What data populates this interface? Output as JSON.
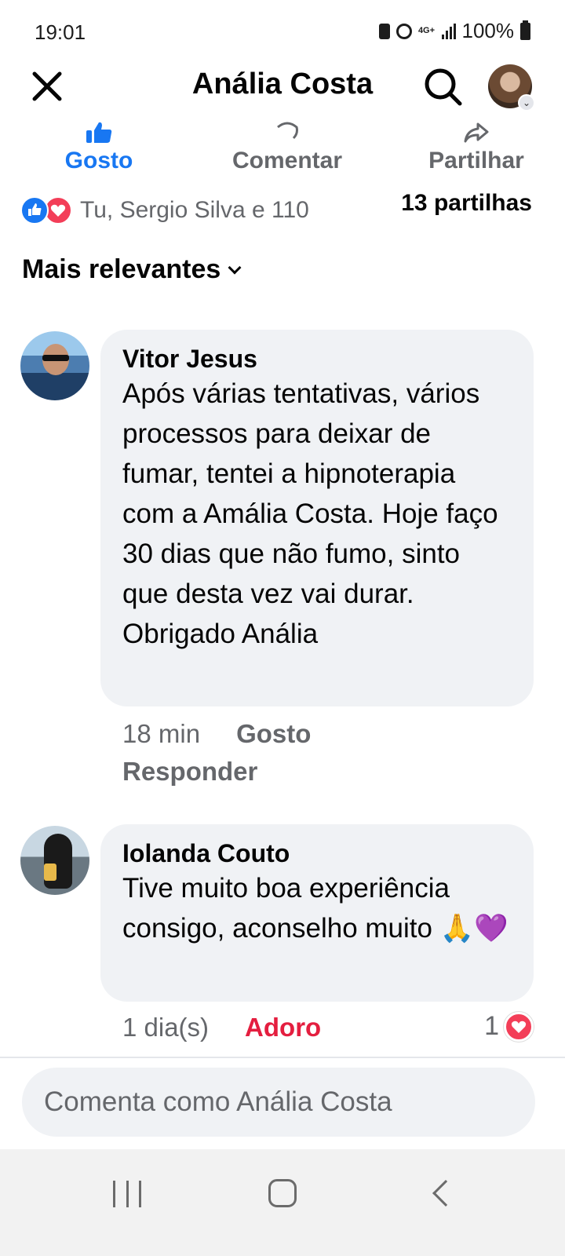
{
  "status_bar": {
    "time": "19:01",
    "network": "4G+",
    "battery": "100%"
  },
  "header": {
    "title": "Anália Costa",
    "icons": [
      "close-icon",
      "search-icon",
      "profile-avatar"
    ]
  },
  "actions": {
    "like": {
      "label": "Gosto",
      "icon": "thumbs-up-icon",
      "active": true
    },
    "comment": {
      "label": "Comentar",
      "icon": "comment-icon"
    },
    "share": {
      "label": "Partilhar",
      "icon": "share-icon"
    }
  },
  "reactions_summary": {
    "text": "Tu, Sergio Silva e 110",
    "icons": [
      "like-reaction-icon",
      "love-reaction-icon"
    ]
  },
  "shares": "13 partilhas",
  "sort": {
    "label": "Mais relevantes"
  },
  "comments": [
    {
      "author": "Vitor Jesus",
      "text": "Após várias tentativas, vários processos para deixar de fumar, tentei a hipnoterapia com a Amália Costa. Hoje faço 30 dias que não fumo, sinto que desta vez vai durar. Obrigado Anália",
      "time": "18 min",
      "like_label": "Gosto",
      "reply_label": "Responder"
    },
    {
      "author": "Iolanda Couto",
      "text": "Tive muito boa experiência consigo, aconselho muito 🙏💜",
      "time": "1 dia(s)",
      "reaction_label": "Adoro",
      "reaction_count": "1"
    }
  ],
  "composer": {
    "placeholder": "Comenta como Anália Costa"
  },
  "colors": {
    "accent_blue": "#1877f2",
    "love_red": "#e41e3f",
    "secondary_text": "#65676b",
    "bubble_bg": "#f0f2f5"
  }
}
